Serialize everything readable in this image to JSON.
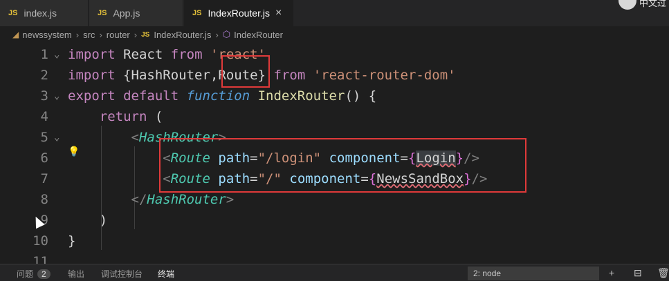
{
  "tabs": [
    {
      "label": "index.js",
      "icon": "JS"
    },
    {
      "label": "App.js",
      "icon": "JS"
    },
    {
      "label": "IndexRouter.js",
      "icon": "JS",
      "close": "×"
    }
  ],
  "topright": {
    "text": "中文过"
  },
  "breadcrumb": {
    "items": [
      "newssystem",
      "src",
      "router",
      "IndexRouter.js",
      "IndexRouter"
    ],
    "separator": "›"
  },
  "editor": {
    "lines": [
      {
        "num": "1",
        "fold": "⌄"
      },
      {
        "num": "2"
      },
      {
        "num": "3",
        "fold": "⌄"
      },
      {
        "num": "4"
      },
      {
        "num": "5",
        "fold": "⌄"
      },
      {
        "num": "6"
      },
      {
        "num": "7"
      },
      {
        "num": "8"
      },
      {
        "num": "9"
      },
      {
        "num": "10"
      },
      {
        "num": "11"
      }
    ],
    "tokens": {
      "import": "import",
      "from": "from",
      "React": "React",
      "react_str": "'react'",
      "brace_open": "{",
      "brace_close": "}",
      "HashRouter_import": "HashRouter",
      "comma": ",",
      "Route_import": "Route",
      "rrd_str": "'react-router-dom'",
      "export": "export",
      "default": "default",
      "function": "function",
      "IndexRouter": "IndexRouter",
      "parens": "()",
      "open_curly": "{",
      "return": "return",
      "paren_open": "(",
      "paren_close": ")",
      "close_curly": "}",
      "lt": "<",
      "gt": ">",
      "lt_slash": "</",
      "self_close": "/>",
      "HashRouter": "HashRouter",
      "Route": "Route",
      "path": "path",
      "eq": "=",
      "component": "component",
      "path_login": "\"/login\"",
      "path_root": "\"/\"",
      "Login": "Login",
      "NewsSandBox": "NewsSandBox"
    }
  },
  "bottom": {
    "problems": "问题",
    "problems_count": "2",
    "output": "输出",
    "debug": "调试控制台",
    "terminal": "终端",
    "terminal_select": "2: node",
    "icons": [
      "+",
      "⊟",
      "🗑"
    ]
  },
  "colors": {
    "highlight_box": "#e03a3a",
    "keyword": "#c586c0",
    "string": "#ce9178",
    "tag": "#4ec9b0"
  }
}
